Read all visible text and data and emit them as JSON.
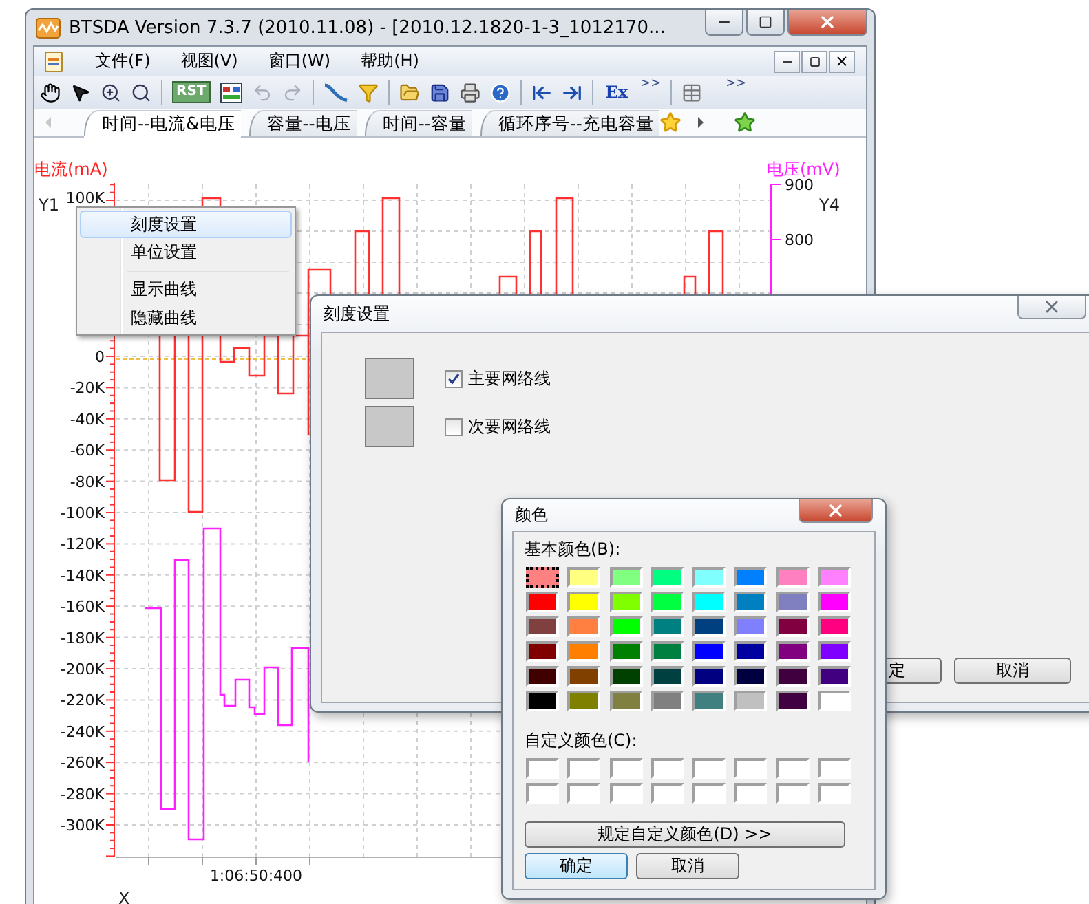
{
  "window": {
    "title": "BTSDA Version 7.3.7 (2010.11.08)    - [2010.12.1820-1-3_1012170..."
  },
  "menu": [
    "文件(F)",
    "视图(V)",
    "窗口(W)",
    "帮助(H)"
  ],
  "toolbar": {
    "reset_label": "RST",
    "export_label": "Ex",
    "more": [
      ">>",
      ">>"
    ]
  },
  "tabs": [
    {
      "label": "时间--电流&电压",
      "selected": true
    },
    {
      "label": "容量--电压",
      "selected": false
    },
    {
      "label": "时间--容量",
      "selected": false
    },
    {
      "label": "循环序号--充电容量",
      "selected": false
    }
  ],
  "chart": {
    "left_axis": {
      "title": "电流(mA)",
      "name": "Y1",
      "ticks": [
        "100K",
        "0",
        "-20K",
        "-40K",
        "-60K",
        "-80K",
        "-100K",
        "-120K",
        "-140K",
        "-160K",
        "-180K",
        "-200K",
        "-220K",
        "-240K",
        "-260K",
        "-280K",
        "-300K"
      ]
    },
    "right_axis": {
      "title": "电压(mV)",
      "name": "Y4",
      "ticks": [
        "900",
        "800"
      ]
    },
    "x_axis": {
      "name": "X",
      "ticks": [
        "1:06:50:400"
      ]
    }
  },
  "context_menu": [
    {
      "label": "刻度设置",
      "selected": true,
      "separator_before": false
    },
    {
      "label": "单位设置",
      "selected": false,
      "separator_before": false
    },
    {
      "label": "显示曲线",
      "selected": false,
      "separator_before": true
    },
    {
      "label": "隐藏曲线",
      "selected": false,
      "separator_before": false
    }
  ],
  "scale_dialog": {
    "title": "刻度设置",
    "options": [
      {
        "label": "主要网络线",
        "checked": true
      },
      {
        "label": "次要网络线",
        "checked": false
      }
    ],
    "buttons": [
      "定",
      "取消"
    ]
  },
  "color_dialog": {
    "title": "颜色",
    "basic_label": "基本颜色(B):",
    "basic_colors": [
      {
        "color": "#ff8080",
        "selected": true
      },
      {
        "color": "#ffff80",
        "selected": false
      },
      {
        "color": "#80ff80",
        "selected": false
      },
      {
        "color": "#00ff80",
        "selected": false
      },
      {
        "color": "#80ffff",
        "selected": false
      },
      {
        "color": "#0080ff",
        "selected": false
      },
      {
        "color": "#ff80c0",
        "selected": false
      },
      {
        "color": "#ff80ff",
        "selected": false
      },
      {
        "color": "#ff0000",
        "selected": false
      },
      {
        "color": "#ffff00",
        "selected": false
      },
      {
        "color": "#80ff00",
        "selected": false
      },
      {
        "color": "#00ff40",
        "selected": false
      },
      {
        "color": "#00ffff",
        "selected": false
      },
      {
        "color": "#0080c0",
        "selected": false
      },
      {
        "color": "#8080c0",
        "selected": false
      },
      {
        "color": "#ff00ff",
        "selected": false
      },
      {
        "color": "#804040",
        "selected": false
      },
      {
        "color": "#ff8040",
        "selected": false
      },
      {
        "color": "#00ff00",
        "selected": false
      },
      {
        "color": "#008080",
        "selected": false
      },
      {
        "color": "#004080",
        "selected": false
      },
      {
        "color": "#8080ff",
        "selected": false
      },
      {
        "color": "#800040",
        "selected": false
      },
      {
        "color": "#ff0080",
        "selected": false
      },
      {
        "color": "#800000",
        "selected": false
      },
      {
        "color": "#ff8000",
        "selected": false
      },
      {
        "color": "#008000",
        "selected": false
      },
      {
        "color": "#008040",
        "selected": false
      },
      {
        "color": "#0000ff",
        "selected": false
      },
      {
        "color": "#0000a0",
        "selected": false
      },
      {
        "color": "#800080",
        "selected": false
      },
      {
        "color": "#8000ff",
        "selected": false
      },
      {
        "color": "#400000",
        "selected": false
      },
      {
        "color": "#804000",
        "selected": false
      },
      {
        "color": "#004000",
        "selected": false
      },
      {
        "color": "#004040",
        "selected": false
      },
      {
        "color": "#000080",
        "selected": false
      },
      {
        "color": "#000040",
        "selected": false
      },
      {
        "color": "#400040",
        "selected": false
      },
      {
        "color": "#400080",
        "selected": false
      },
      {
        "color": "#000000",
        "selected": false
      },
      {
        "color": "#808000",
        "selected": false
      },
      {
        "color": "#808040",
        "selected": false
      },
      {
        "color": "#808080",
        "selected": false
      },
      {
        "color": "#408080",
        "selected": false
      },
      {
        "color": "#c0c0c0",
        "selected": false
      },
      {
        "color": "#400041",
        "selected": false
      },
      {
        "color": "#ffffff",
        "selected": false
      }
    ],
    "custom_label": "自定义颜色(C):",
    "define_button": "规定自定义颜色(D) >>",
    "buttons": [
      "确定",
      "取消"
    ]
  }
}
